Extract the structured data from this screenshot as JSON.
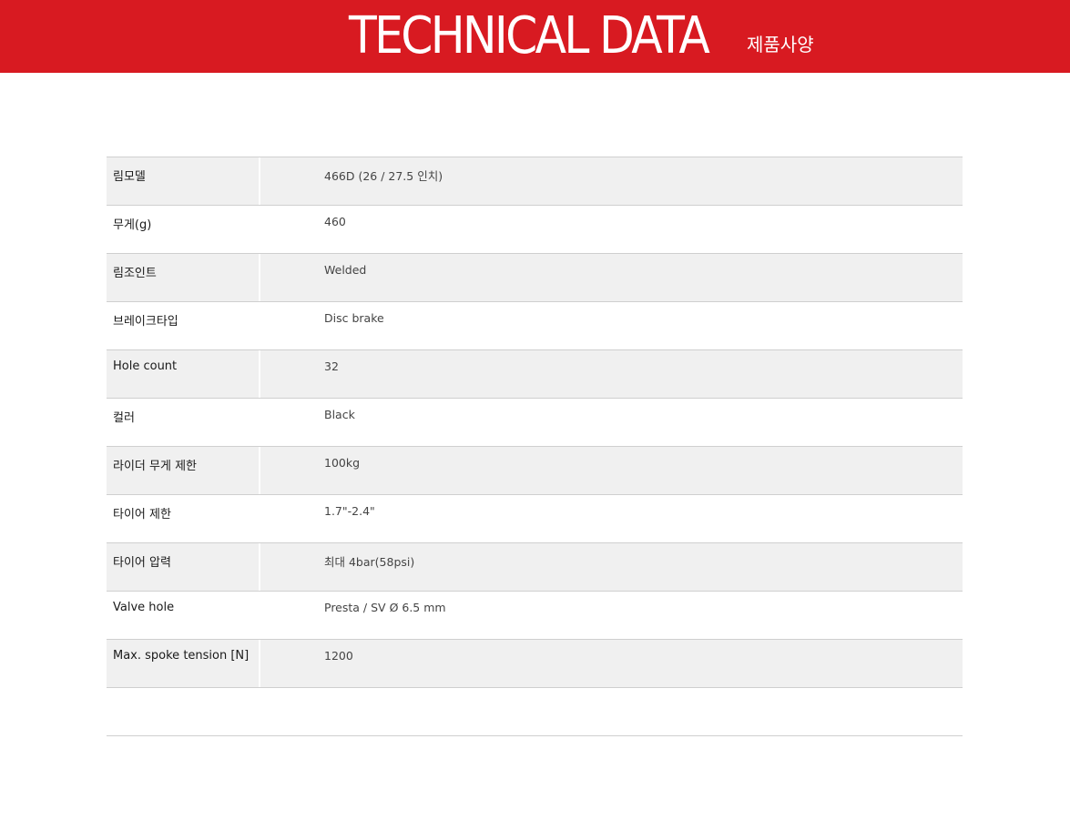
{
  "header": {
    "title": "TECHNICAL DATA",
    "subtitle": "제품사양",
    "background_color": "#d81a21"
  },
  "specs": [
    {
      "label": "림모델",
      "value": "466D (26 / 27.5 인치)"
    },
    {
      "label": "무게(g)",
      "value": "460"
    },
    {
      "label": "림조인트",
      "value": "Welded"
    },
    {
      "label": "브레이크타입",
      "value": "Disc brake"
    },
    {
      "label": "Hole count",
      "value": "32"
    },
    {
      "label": "컬러",
      "value": "Black"
    },
    {
      "label": "라이더 무게 제한",
      "value": "100kg"
    },
    {
      "label": "타이어 제한",
      "value": "1.7\"-2.4\""
    },
    {
      "label": "타이어 압력",
      "value": "최대 4bar(58psi)"
    },
    {
      "label": "Valve hole",
      "value": "Presta / SV Ø 6.5 mm"
    },
    {
      "label": "Max. spoke tension [N]",
      "value": "1200"
    },
    {
      "label": "",
      "value": ""
    }
  ]
}
